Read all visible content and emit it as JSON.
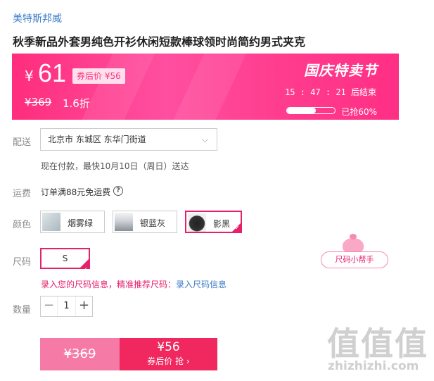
{
  "store": {
    "name": "美特斯邦威"
  },
  "product": {
    "title": "秋季新品外套男纯色开衫休闲短款棒球领时尚简约男式夹克"
  },
  "promo": {
    "currency": "¥",
    "price": "61",
    "after_coupon": "券后价 ¥56",
    "original_price": "¥369",
    "discount": "1.6折",
    "festival": "国庆特卖节",
    "timer": "15 : 47 : 21  后结束",
    "sold_text": "已抢60%",
    "sold_fraction": 0.6,
    "colors": {
      "from": "#ff2d7d",
      "to": "#ff3c8e"
    }
  },
  "shipping": {
    "label": "配送",
    "address": "北京市 东城区 东华门街道",
    "note": "现在付款，最快10月10日（周日）送达"
  },
  "fee": {
    "label": "运费",
    "text": "订单满88元免运费",
    "help_icon": "?"
  },
  "color": {
    "label": "颜色",
    "options": [
      {
        "name": "烟雾绿",
        "selected": false
      },
      {
        "name": "银蓝灰",
        "selected": false
      },
      {
        "name": "影黑",
        "selected": true
      }
    ]
  },
  "size": {
    "label": "尺码",
    "options": [
      {
        "name": "S",
        "selected": true
      }
    ],
    "helper": "尺码小帮手",
    "note": "录入您的尺码信息，精准推荐尺码：",
    "note_link": "录入尺码信息"
  },
  "quantity": {
    "label": "数量",
    "value": "1",
    "minus": "−",
    "plus": "+"
  },
  "buy": {
    "original": "¥369",
    "price": "¥56",
    "coupon_cta": "券后价 抢 ›"
  },
  "watermark": {
    "text": "值值值",
    "url": "zhizhizhi.com"
  }
}
